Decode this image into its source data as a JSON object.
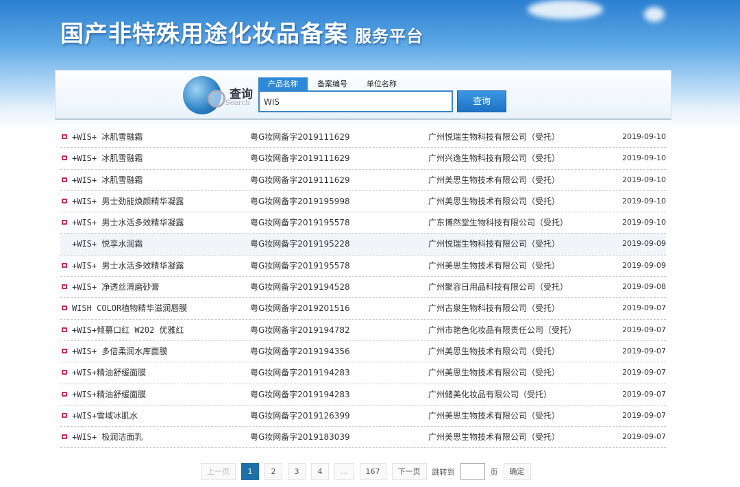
{
  "header": {
    "title": "国产非特殊用途化妆品备案",
    "subtitle": "服务平台"
  },
  "search": {
    "label": "查询",
    "label_en": "Search",
    "tabs": [
      "产品名称",
      "备案编号",
      "单位名称"
    ],
    "active_tab": 0,
    "value": "WIS",
    "button": "查询"
  },
  "rows": [
    {
      "name": "+WIS+ 冰肌雪融霜",
      "no": "粤G妆网备字2019111629",
      "company": "广州悦瑞生物科技有限公司（受托）",
      "date": "2019-09-10"
    },
    {
      "name": "+WIS+ 冰肌雪融霜",
      "no": "粤G妆网备字2019111629",
      "company": "广州兴逸生物科技有限公司（受托）",
      "date": "2019-09-10"
    },
    {
      "name": "+WIS+ 冰肌雪融霜",
      "no": "粤G妆网备字2019111629",
      "company": "广州美思生物技术有限公司（受托）",
      "date": "2019-09-10"
    },
    {
      "name": "+WIS+ 男士劲能焕颜精华凝露",
      "no": "粤G妆网备字2019195998",
      "company": "广州美思生物技术有限公司（受托）",
      "date": "2019-09-10"
    },
    {
      "name": "+WIS+ 男士水活多效精华凝露",
      "no": "粤G妆网备字2019195578",
      "company": "广东博然堂生物科技有限公司（受托）",
      "date": "2019-09-10"
    },
    {
      "name": "+WIS+ 悦享水润霜",
      "no": "粤G妆网备字2019195228",
      "company": "广州悦瑞生物科技有限公司（受托）",
      "date": "2019-09-09"
    },
    {
      "name": "+WIS+ 男士水活多效精华凝露",
      "no": "粤G妆网备字2019195578",
      "company": "广州美思生物技术有限公司（受托）",
      "date": "2019-09-09"
    },
    {
      "name": "+WIS+ 净透丝滑磨砂膏",
      "no": "粤G妆网备字2019194528",
      "company": "广州聚容日用品科技有限公司（受托）",
      "date": "2019-09-08"
    },
    {
      "name": "WISH COLOR植物精华滋润唇膜",
      "no": "粤G妆网备字2019201516",
      "company": "广州古泉生物科技有限公司（受托）",
      "date": "2019-09-07"
    },
    {
      "name": "+WIS+倾慕口红 W202 优雅红",
      "no": "粤G妆网备字2019194782",
      "company": "广州市艳色化妆品有限责任公司（受托）",
      "date": "2019-09-07"
    },
    {
      "name": "+WIS+ 多倍柔润水库面膜",
      "no": "粤G妆网备字2019194356",
      "company": "广州美思生物技术有限公司（受托）",
      "date": "2019-09-07"
    },
    {
      "name": "+WIS+精油舒缓面膜",
      "no": "粤G妆网备字2019194283",
      "company": "广州美思生物技术有限公司（受托）",
      "date": "2019-09-07"
    },
    {
      "name": "+WIS+精油舒缓面膜",
      "no": "粤G妆网备字2019194283",
      "company": "广州储美化妆品有限公司（受托）",
      "date": "2019-09-07"
    },
    {
      "name": "+WIS+雪域冰肌水",
      "no": "粤G妆网备字2019126399",
      "company": "广州美思生物技术有限公司（受托）",
      "date": "2019-09-07"
    },
    {
      "name": "+WIS+ 极润洁面乳",
      "no": "粤G妆网备字2019183039",
      "company": "广州美思生物技术有限公司（受托）",
      "date": "2019-09-07"
    }
  ],
  "pager": {
    "prev": "上一页",
    "pages": [
      "1",
      "2",
      "3",
      "4",
      "...",
      "167"
    ],
    "current": "1",
    "next": "下一页",
    "jump_label": "跳转到",
    "page_unit": "页",
    "confirm": "确定"
  }
}
